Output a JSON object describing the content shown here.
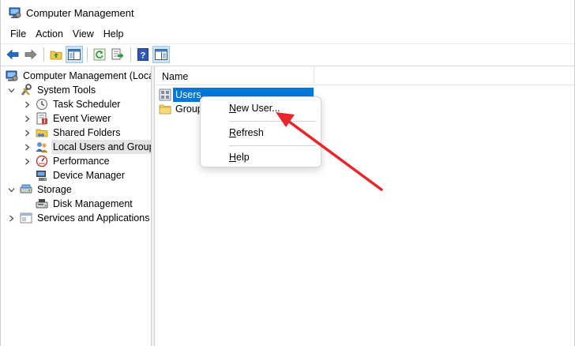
{
  "window": {
    "title": "Computer Management"
  },
  "menu": [
    "File",
    "Action",
    "View",
    "Help"
  ],
  "toolbar": {
    "buttons": [
      "back-icon",
      "forward-icon",
      "up-folder-icon",
      "show-hide-tree-icon",
      "refresh-icon",
      "export-list-icon",
      "help-icon",
      "show-hide-action-pane-icon"
    ]
  },
  "tree": {
    "root": "Computer Management (Local",
    "system_tools": "System Tools",
    "task_scheduler": "Task Scheduler",
    "event_viewer": "Event Viewer",
    "shared_folders": "Shared Folders",
    "local_users_groups": "Local Users and Groups",
    "performance": "Performance",
    "device_manager": "Device Manager",
    "storage": "Storage",
    "disk_management": "Disk Management",
    "services_apps": "Services and Applications"
  },
  "list": {
    "column_name": "Name",
    "items": [
      "Users",
      "Group"
    ]
  },
  "context_menu": {
    "new_user_prefix": "N",
    "new_user_rest": "ew User...",
    "refresh_prefix": "R",
    "refresh_rest": "efresh",
    "help_prefix": "H",
    "help_rest": "elp"
  },
  "annotation": {
    "arrow_color": "#e8262b"
  }
}
